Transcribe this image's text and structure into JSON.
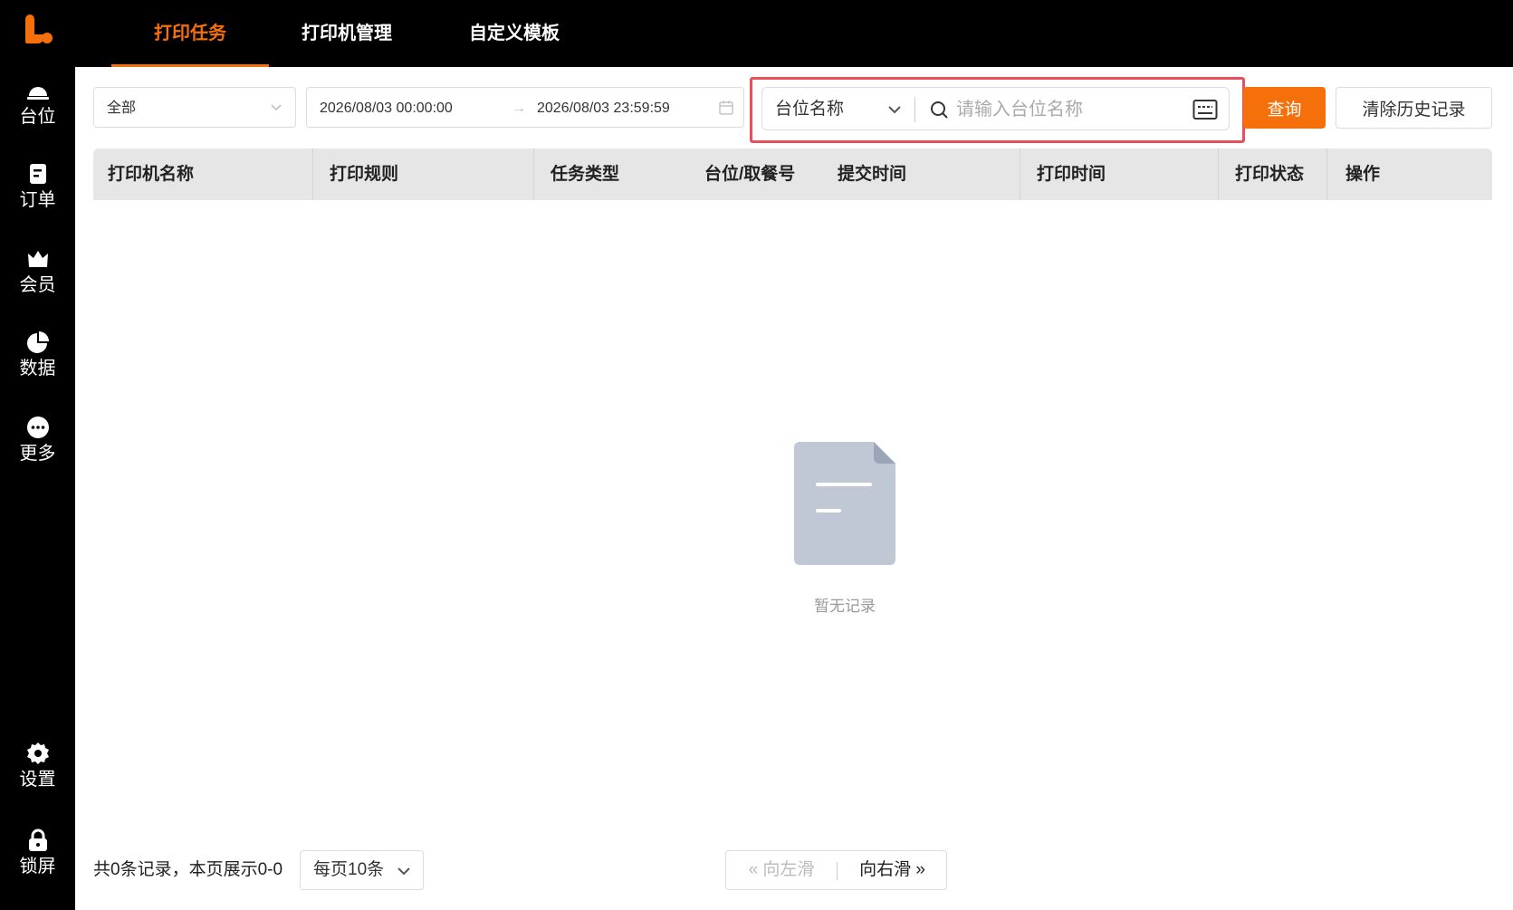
{
  "sidebar": {
    "logo": "brand-logo",
    "items": [
      {
        "label": "台位",
        "icon": "table-bell-icon"
      },
      {
        "label": "订单",
        "icon": "order-doc-icon"
      },
      {
        "label": "会员",
        "icon": "crown-icon"
      },
      {
        "label": "数据",
        "icon": "pie-chart-icon"
      },
      {
        "label": "更多",
        "icon": "more-dots-icon"
      }
    ],
    "bottom_items": [
      {
        "label": "设置",
        "icon": "gear-icon"
      },
      {
        "label": "锁屏",
        "icon": "lock-icon"
      }
    ]
  },
  "tabs": [
    {
      "label": "打印任务",
      "active": true
    },
    {
      "label": "打印机管理",
      "active": false
    },
    {
      "label": "自定义模板",
      "active": false
    }
  ],
  "filters": {
    "status_value": "全部",
    "date_start": "2026/08/03 00:00:00",
    "date_arrow": "→",
    "date_end": "2026/08/03 23:59:59",
    "search_type": "台位名称",
    "search_placeholder": "请输入台位名称",
    "query_label": "查询",
    "clear_label": "清除历史记录"
  },
  "table": {
    "columns": [
      "打印机名称",
      "打印规则",
      "任务类型",
      "台位/取餐号",
      "提交时间",
      "打印时间",
      "打印状态",
      "操作"
    ],
    "rows": [],
    "empty_text": "暂无记录"
  },
  "footer": {
    "summary": "共0条记录，本页展示0-0",
    "page_size": "每页10条",
    "prev_label": "向左滑",
    "next_label": "向右滑"
  },
  "colors": {
    "accent": "#f5700a",
    "highlight": "#e8505b",
    "sidebar_bg": "#000000",
    "header_bg": "#e6e6e6"
  }
}
